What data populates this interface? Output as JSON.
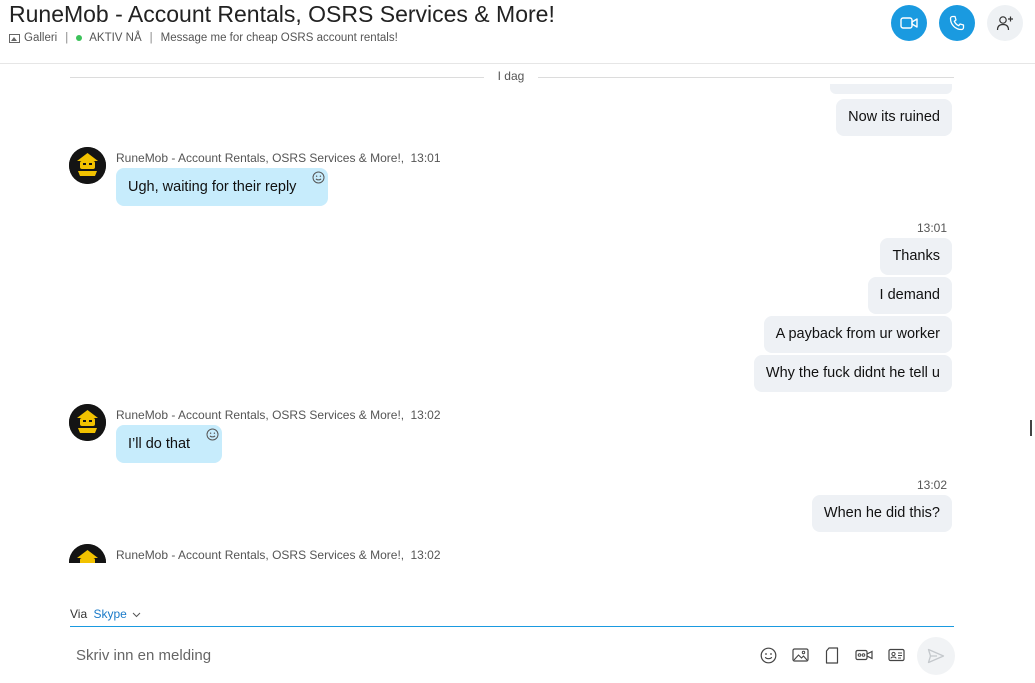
{
  "header": {
    "title": "RuneMob - Account Rentals, OSRS Services & More!",
    "gallery_label": "Galleri",
    "status": "AKTIV NÅ",
    "mood": "Message me for cheap OSRS account rentals!",
    "icons": {
      "video": "video-camera-icon",
      "call": "phone-icon",
      "add_people": "add-person-icon"
    }
  },
  "day_divider": "I dag",
  "messages": {
    "m1": {
      "text": "Now its ruined"
    },
    "g1": {
      "sender": "RuneMob - Account Rentals, OSRS Services & More!,",
      "time": "13:01",
      "text": "Ugh, waiting for their reply"
    },
    "out_time_1": "13:01",
    "m2": {
      "text": "Thanks"
    },
    "m3": {
      "text": "I demand"
    },
    "m4": {
      "text": "A payback from ur worker"
    },
    "m5": {
      "text": "Why the fuck didnt he tell u"
    },
    "g2": {
      "sender": "RuneMob - Account Rentals, OSRS Services & More!,",
      "time": "13:02",
      "text": "I’ll do that"
    },
    "out_time_2": "13:02",
    "m6": {
      "text": "When he did this?"
    },
    "g3": {
      "sender": "RuneMob - Account Rentals, OSRS Services & More!,",
      "time": "13:02"
    }
  },
  "composer": {
    "via_label": "Via",
    "via_service": "Skype",
    "placeholder": "Skriv inn en melding",
    "tools": [
      "emoji-icon",
      "image-icon",
      "file-icon",
      "video-message-icon",
      "contact-card-icon"
    ],
    "send_icon": "send-icon"
  },
  "colors": {
    "accent": "#1a9ae0",
    "incoming_bubble": "#c7ecfc",
    "outgoing_bubble": "#eef1f5",
    "online": "#3cc25a"
  }
}
